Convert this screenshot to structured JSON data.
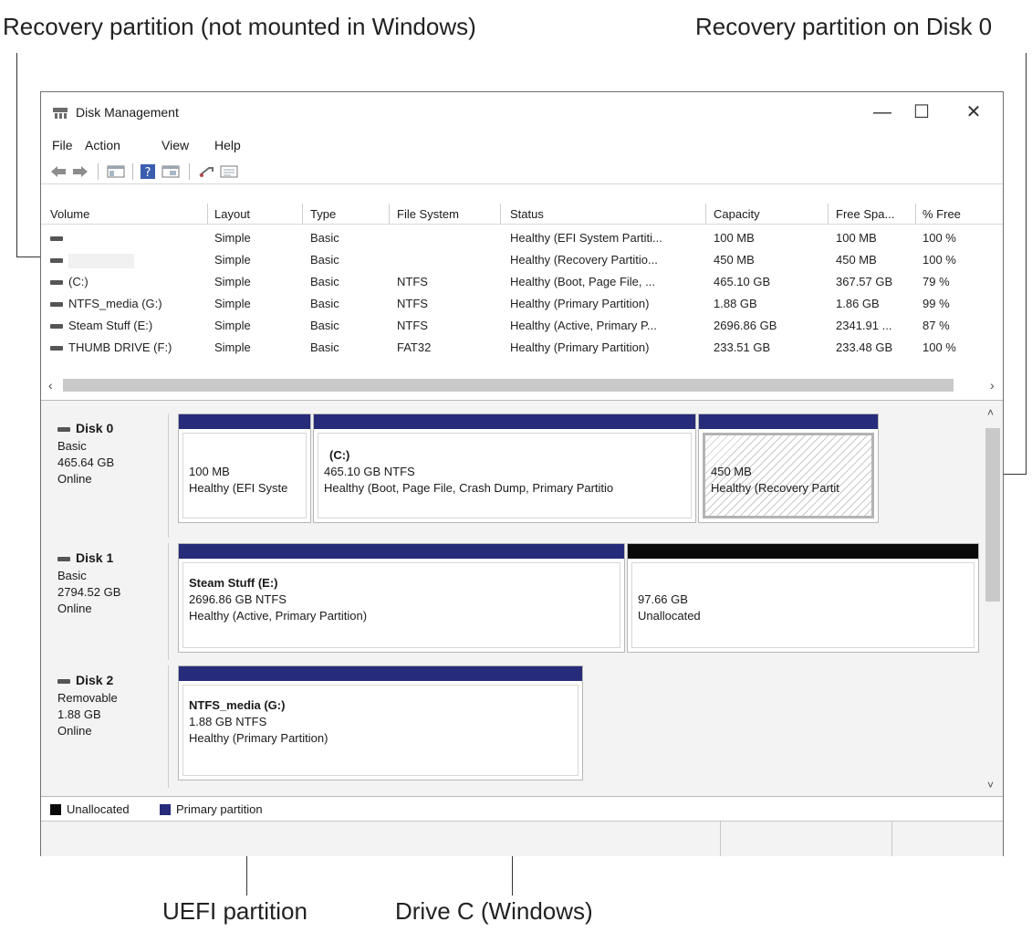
{
  "annotations": {
    "top_left": "Recovery partition (not mounted in Windows)",
    "top_right": "Recovery partition on Disk 0",
    "bottom_left": "UEFI partition",
    "bottom_right": "Drive C (Windows)"
  },
  "window": {
    "title": "Disk Management",
    "minimize": "—",
    "maximize": "☐",
    "close": "✕"
  },
  "menu": [
    "File",
    "Action",
    "View",
    "Help"
  ],
  "toolbar": [
    "back-icon",
    "forward-icon",
    "console-tree-icon",
    "help-icon",
    "properties-icon",
    "rescan-icon",
    "detail-pane-icon"
  ],
  "table": {
    "headers": [
      "Volume",
      "Layout",
      "Type",
      "File System",
      "Status",
      "Capacity",
      "Free Spa...",
      "% Free"
    ],
    "rows": [
      [
        "",
        "Simple",
        "Basic",
        "",
        "Healthy (EFI System Partiti...",
        "100 MB",
        "100 MB",
        "100 %"
      ],
      [
        "",
        "Simple",
        "Basic",
        "",
        "Healthy (Recovery Partitio...",
        "450 MB",
        "450 MB",
        "100 %"
      ],
      [
        "(C:)",
        "Simple",
        "Basic",
        "NTFS",
        "Healthy (Boot, Page File, ...",
        "465.10 GB",
        "367.57 GB",
        "79 %"
      ],
      [
        "NTFS_media (G:)",
        "Simple",
        "Basic",
        "NTFS",
        "Healthy (Primary Partition)",
        "1.88 GB",
        "1.86 GB",
        "99 %"
      ],
      [
        "Steam Stuff (E:)",
        "Simple",
        "Basic",
        "NTFS",
        "Healthy (Active, Primary P...",
        "2696.86 GB",
        "2341.91 ...",
        "87 %"
      ],
      [
        "THUMB DRIVE (F:)",
        "Simple",
        "Basic",
        "FAT32",
        "Healthy (Primary Partition)",
        "233.51 GB",
        "233.48 GB",
        "100 %"
      ]
    ]
  },
  "disks": [
    {
      "name": "Disk 0",
      "kind": "Basic",
      "size": "465.64 GB",
      "state": "Online",
      "partitions": [
        {
          "title": "",
          "line1": "100 MB",
          "line2": "Healthy (EFI Syste"
        },
        {
          "title": "(C:)",
          "line1": "465.10 GB NTFS",
          "line2": "Healthy (Boot, Page File, Crash Dump, Primary Partitio"
        },
        {
          "title": "",
          "line1": "450 MB",
          "line2": "Healthy (Recovery Partit"
        }
      ]
    },
    {
      "name": "Disk 1",
      "kind": "Basic",
      "size": "2794.52 GB",
      "state": "Online",
      "partitions": [
        {
          "title": "Steam Stuff  (E:)",
          "line1": "2696.86 GB NTFS",
          "line2": "Healthy (Active, Primary Partition)"
        },
        {
          "title": "",
          "line1": "97.66 GB",
          "line2": "Unallocated"
        }
      ]
    },
    {
      "name": "Disk 2",
      "kind": "Removable",
      "size": "1.88 GB",
      "state": "Online",
      "partitions": [
        {
          "title": "NTFS_media  (G:)",
          "line1": "1.88 GB NTFS",
          "line2": "Healthy (Primary Partition)"
        }
      ]
    }
  ],
  "legend": [
    "Unallocated",
    "Primary partition"
  ],
  "colors": {
    "primary": "#262b7a",
    "unallocated": "#0a0a0a",
    "window_border": "#6f6f6f"
  }
}
